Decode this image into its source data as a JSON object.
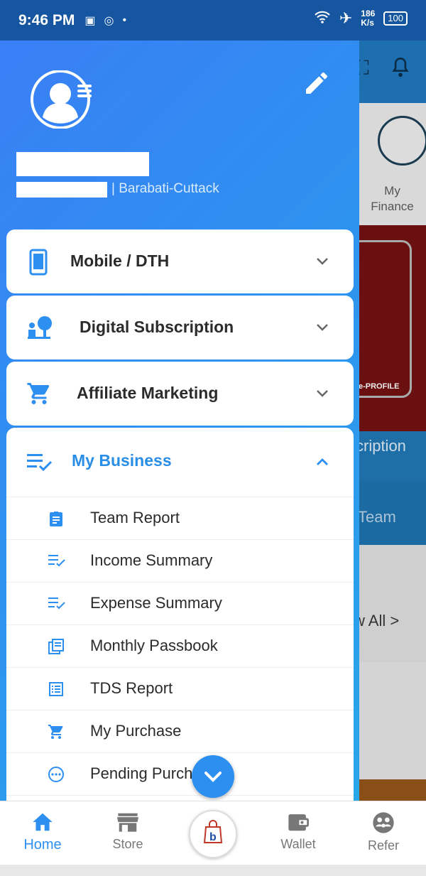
{
  "status_bar": {
    "time": "9:46 PM",
    "speed_value": "186",
    "speed_unit": "K/s",
    "battery": "100"
  },
  "background": {
    "finance_label_line1": "My",
    "finance_label_line2": "Finance",
    "promo_text": "e-PROFILE",
    "tab1_fragment": "scription",
    "tab2_fragment": "Team",
    "view_all_fragment": "w All >"
  },
  "profile": {
    "location": "| Barabati-Cuttack"
  },
  "menu": {
    "mobile_dth": "Mobile / DTH",
    "digital_subscription": "Digital Subscription",
    "affiliate_marketing": "Affiliate Marketing",
    "my_business": "My Business",
    "business_items": [
      {
        "label": "Team Report",
        "icon": "clipboard-icon"
      },
      {
        "label": "Income Summary",
        "icon": "list-check-icon"
      },
      {
        "label": "Expense Summary",
        "icon": "list-check-icon"
      },
      {
        "label": "Monthly Passbook",
        "icon": "passbook-icon"
      },
      {
        "label": "TDS Report",
        "icon": "report-list-icon"
      },
      {
        "label": "My Purchase",
        "icon": "cart-icon"
      },
      {
        "label": "Pending Purchase",
        "icon": "pending-icon"
      }
    ]
  },
  "bottom_nav": {
    "home": "Home",
    "store": "Store",
    "wallet": "Wallet",
    "refer": "Refer"
  },
  "colors": {
    "accent": "#2d8ff0",
    "drawer_gradient_start": "#3a7ff6",
    "drawer_gradient_end": "#28a6ea",
    "status_bar": "#1656a0"
  }
}
